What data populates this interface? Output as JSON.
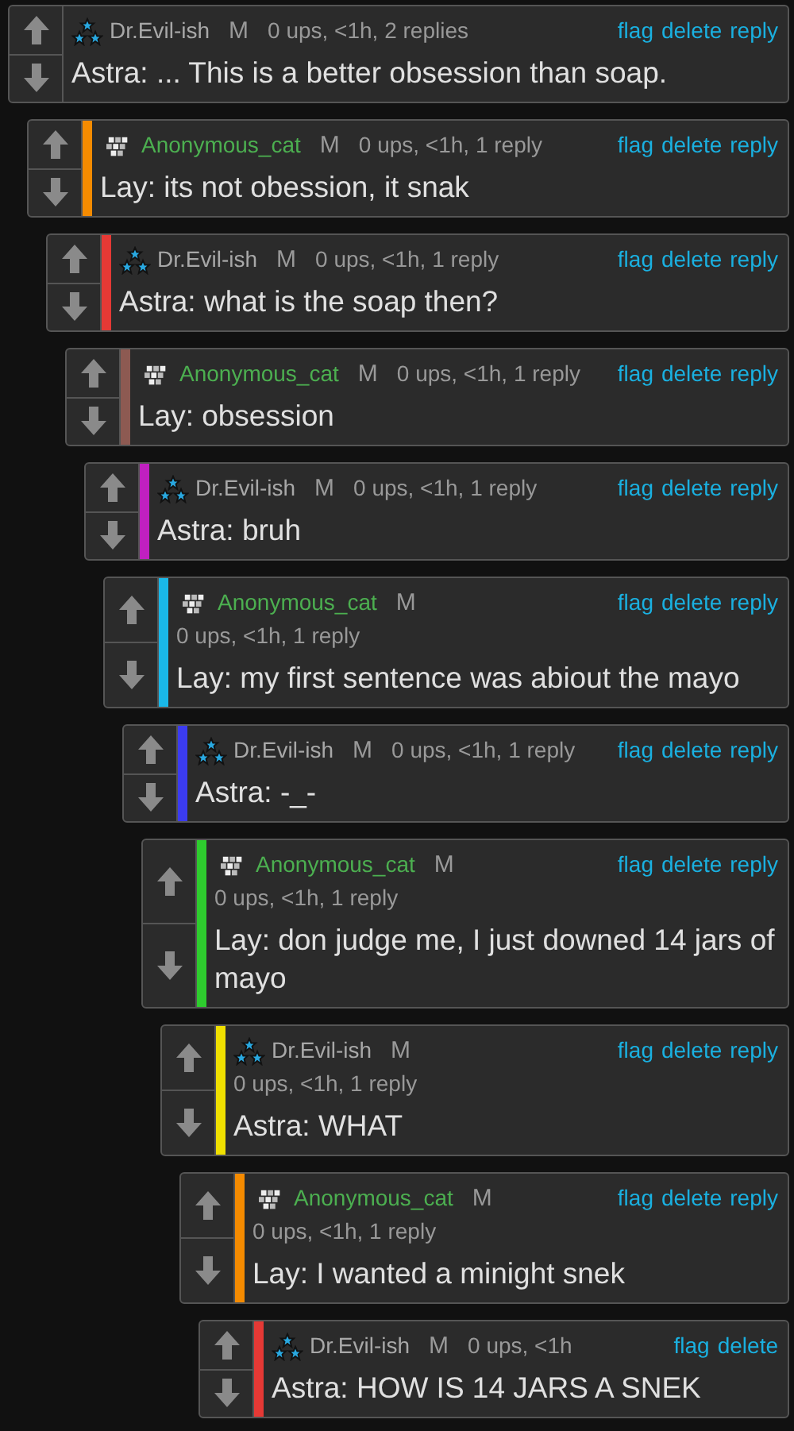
{
  "thread": [
    {
      "user": "Dr.Evil-ish",
      "kind": "stars",
      "badge": "M",
      "meta": "0 ups, <1h, 2 replies",
      "text": "Astra: ... This is a better obsession than soap.",
      "actions": [
        "flag",
        "delete",
        "reply"
      ],
      "children": [
        {
          "user": "Anonymous_cat",
          "kind": "checker",
          "badge": "M",
          "meta": "0 ups, <1h, 1 reply",
          "text": "Lay: its not obession, it snak",
          "color": "#f58b00",
          "actions": [
            "flag",
            "delete",
            "reply"
          ],
          "children": [
            {
              "user": "Dr.Evil-ish",
              "kind": "stars",
              "badge": "M",
              "meta": "0 ups, <1h, 1 reply",
              "text": "Astra: what is the soap then?",
              "color": "#e53935",
              "actions": [
                "flag",
                "delete",
                "reply"
              ],
              "children": [
                {
                  "user": "Anonymous_cat",
                  "kind": "checker",
                  "badge": "M",
                  "meta": "0 ups, <1h, 1 reply",
                  "text": "Lay: obsession",
                  "color": "#8d5a52",
                  "actions": [
                    "flag",
                    "delete",
                    "reply"
                  ],
                  "children": [
                    {
                      "user": "Dr.Evil-ish",
                      "kind": "stars",
                      "badge": "M",
                      "meta": "0 ups, <1h, 1 reply",
                      "text": "Astra: bruh",
                      "color": "#c020c0",
                      "actions": [
                        "flag",
                        "delete",
                        "reply"
                      ],
                      "children": [
                        {
                          "user": "Anonymous_cat",
                          "kind": "checker",
                          "badge": "M",
                          "meta": "0 ups, <1h, 1 reply",
                          "text": "Lay: my first sentence was abiout the mayo",
                          "color": "#1ab8e8",
                          "actions": [
                            "flag",
                            "delete",
                            "reply"
                          ],
                          "children": [
                            {
                              "user": "Dr.Evil-ish",
                              "kind": "stars",
                              "badge": "M",
                              "meta": "0 ups, <1h, 1 reply",
                              "text": "Astra: -_-",
                              "color": "#3b3bf0",
                              "actions": [
                                "flag",
                                "delete",
                                "reply"
                              ],
                              "children": [
                                {
                                  "user": "Anonymous_cat",
                                  "kind": "checker",
                                  "badge": "M",
                                  "meta": "0 ups, <1h, 1 reply",
                                  "text": "Lay: don judge me, I just downed 14 jars of mayo",
                                  "color": "#2ecc2e",
                                  "actions": [
                                    "flag",
                                    "delete",
                                    "reply"
                                  ],
                                  "children": [
                                    {
                                      "user": "Dr.Evil-ish",
                                      "kind": "stars",
                                      "badge": "M",
                                      "meta": "0 ups, <1h, 1 reply",
                                      "text": "Astra: WHAT",
                                      "color": "#f0e000",
                                      "actions": [
                                        "flag",
                                        "delete",
                                        "reply"
                                      ],
                                      "children": [
                                        {
                                          "user": "Anonymous_cat",
                                          "kind": "checker",
                                          "badge": "M",
                                          "meta": "0 ups, <1h, 1 reply",
                                          "text": "Lay: I wanted a minight snek",
                                          "color": "#f58b00",
                                          "actions": [
                                            "flag",
                                            "delete",
                                            "reply"
                                          ],
                                          "children": [
                                            {
                                              "user": "Dr.Evil-ish",
                                              "kind": "stars",
                                              "badge": "M",
                                              "meta": "0 ups, <1h",
                                              "text": "Astra: HOW IS 14 JARS A SNEK",
                                              "color": "#e53935",
                                              "actions": [
                                                "flag",
                                                "delete"
                                              ]
                                            }
                                          ]
                                        }
                                      ]
                                    }
                                  ]
                                }
                              ]
                            }
                          ]
                        }
                      ]
                    }
                  ]
                }
              ]
            }
          ]
        }
      ]
    }
  ]
}
